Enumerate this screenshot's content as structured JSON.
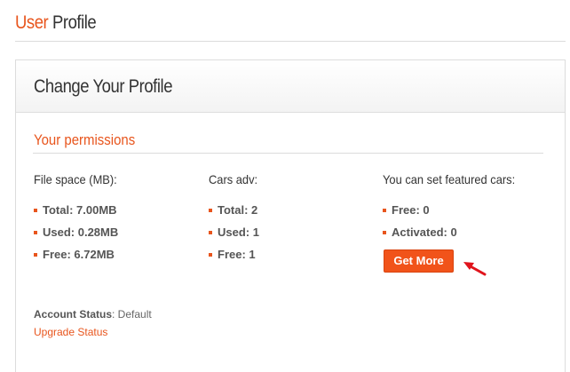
{
  "page": {
    "title_accent": "User",
    "title_rest": "Profile"
  },
  "card": {
    "title": "Change Your Profile",
    "section_title": "Your permissions"
  },
  "columns": [
    {
      "heading": "File space (MB):",
      "items": [
        "Total: 7.00MB",
        "Used: 0.28MB",
        "Free: 6.72MB"
      ]
    },
    {
      "heading": "Cars adv:",
      "items": [
        "Total: 2",
        "Used: 1",
        "Free: 1"
      ]
    },
    {
      "heading": "You can set featured cars:",
      "items": [
        "Free: 0",
        "Activated: 0"
      ]
    }
  ],
  "actions": {
    "get_more_label": "Get More"
  },
  "account": {
    "status_label": "Account Status",
    "status_value": ": Default",
    "upgrade_link": "Upgrade Status"
  },
  "colors": {
    "accent": "#e8551d",
    "button": "#f1531a",
    "arrow": "#e0141c"
  },
  "icons": {
    "pointer": "red-arrow-icon",
    "bullet": "square-bullet-icon"
  }
}
